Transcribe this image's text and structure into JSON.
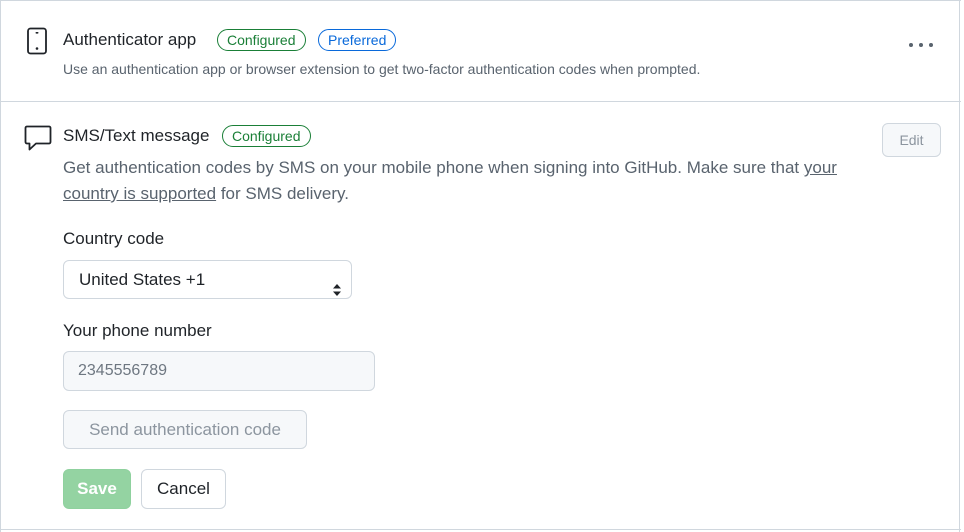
{
  "authenticator": {
    "icon": "mobile-phone-icon",
    "title": "Authenticator app",
    "badge_configured": "Configured",
    "badge_preferred": "Preferred",
    "description": "Use an authentication app or browser extension to get two-factor authentication codes when prompted.",
    "menu_icon": "kebab-horizontal-icon"
  },
  "sms": {
    "icon": "comment-icon",
    "title": "SMS/Text message",
    "badge_configured": "Configured",
    "edit_label": "Edit",
    "description_before": "Get authentication codes by SMS on your mobile phone when signing into GitHub. Make sure that ",
    "description_link": "your country is supported",
    "description_after": " for SMS delivery.",
    "country_label": "Country code",
    "country_value": "United States +1",
    "phone_label": "Your phone number",
    "phone_placeholder": "2345556789",
    "send_code_label": "Send authentication code",
    "save_label": "Save",
    "cancel_label": "Cancel"
  },
  "colors": {
    "configured_badge": "#1a7f37",
    "preferred_badge": "#0969da",
    "save_button_disabled": "#94d3a2",
    "border": "#d0d7de",
    "muted_text": "#59636e"
  }
}
